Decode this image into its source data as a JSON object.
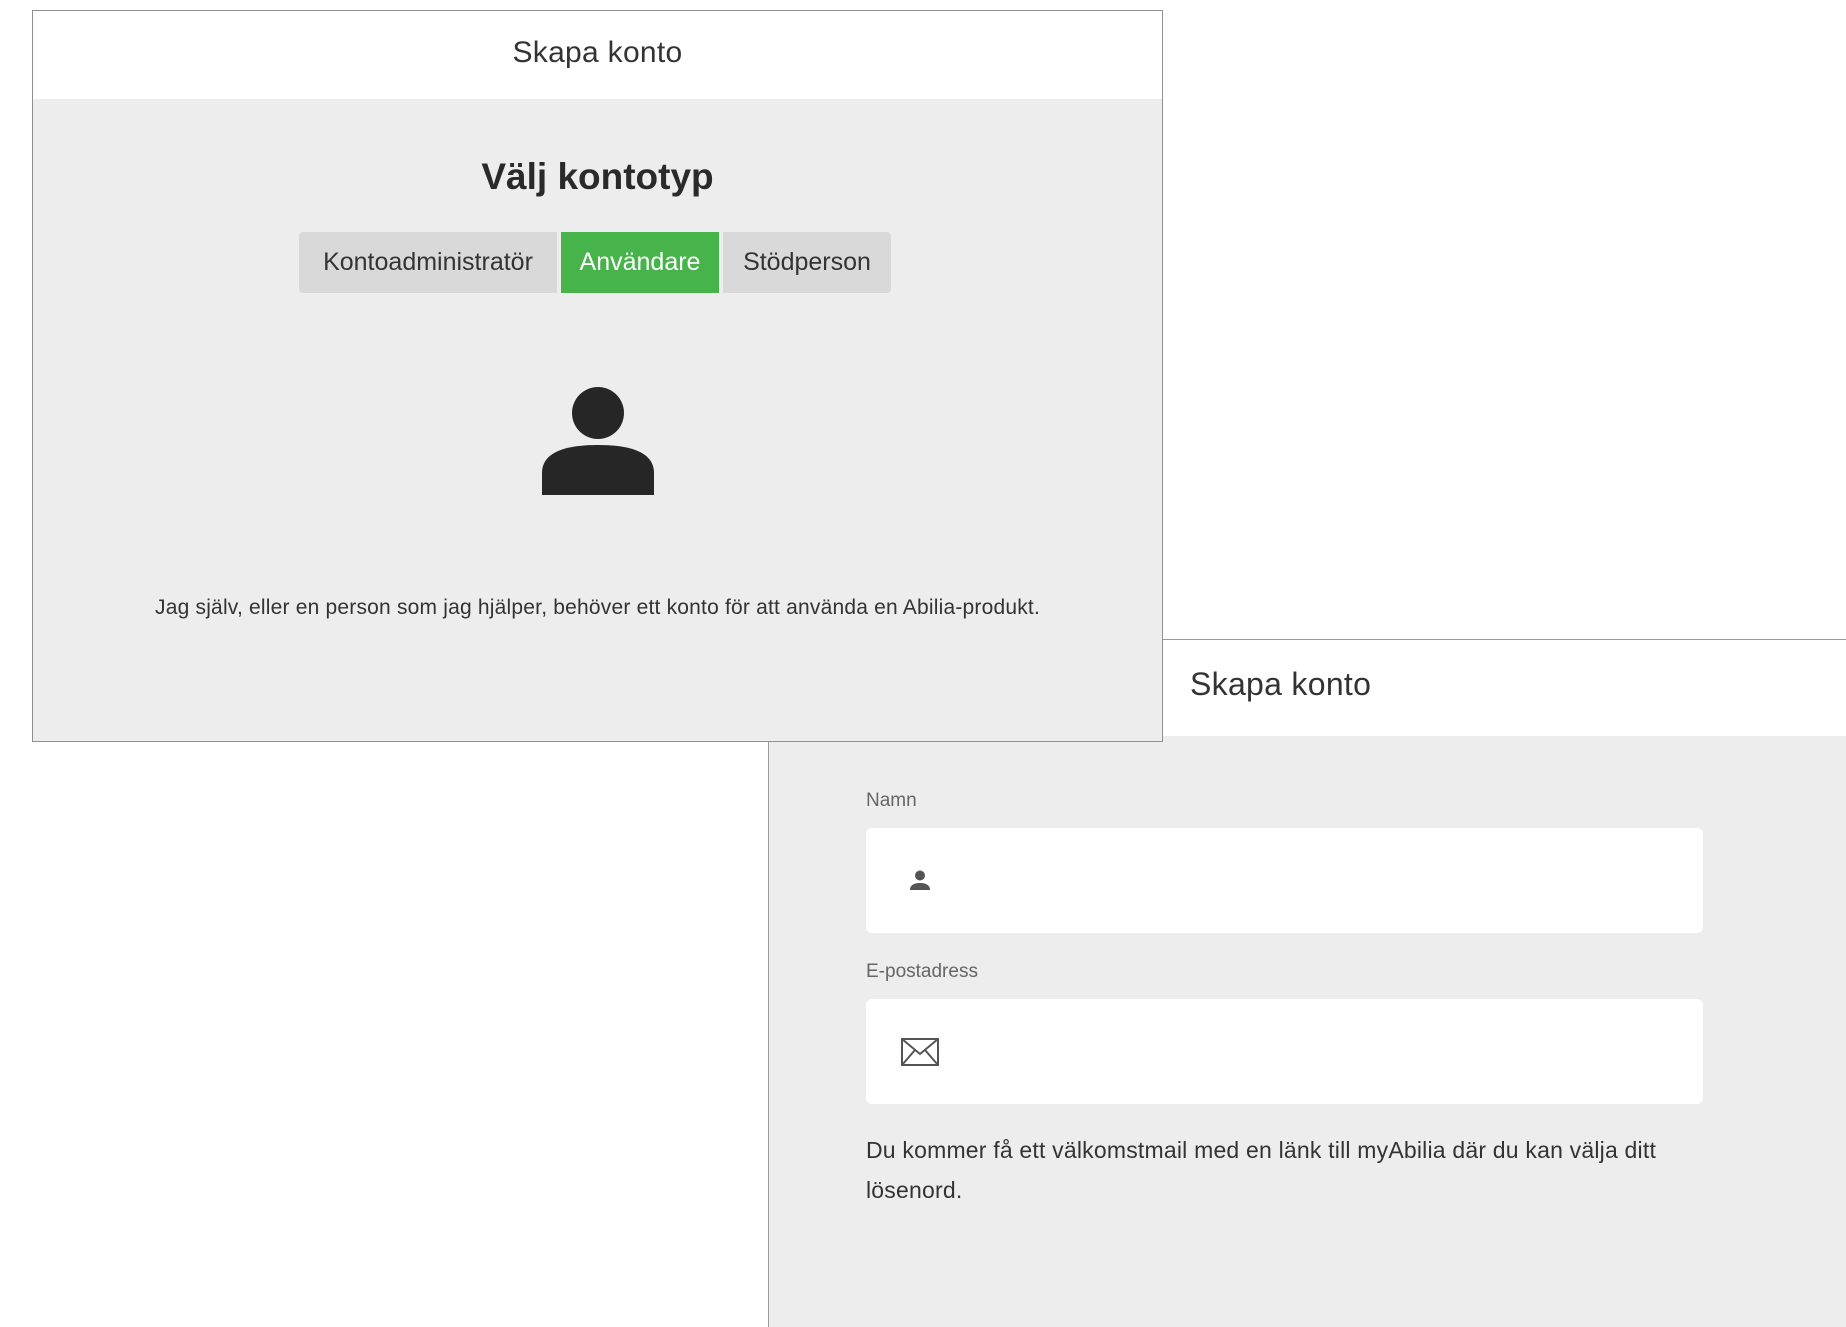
{
  "account_type_dialog": {
    "header_title": "Skapa konto",
    "heading": "Välj kontotyp",
    "options": [
      {
        "label": "Kontoadministratör",
        "selected": false
      },
      {
        "label": "Användare",
        "selected": true
      },
      {
        "label": "Stödperson",
        "selected": false
      }
    ],
    "selected_icon": "person-icon",
    "description": "Jag själv, eller en person som jag hjälper, behöver ett konto för att använda en Abilia-produkt."
  },
  "signup_dialog": {
    "header_title": "Skapa konto",
    "name_field": {
      "label": "Namn",
      "icon": "person-icon",
      "value": ""
    },
    "email_field": {
      "label": "E-postadress",
      "icon": "envelope-icon",
      "value": ""
    },
    "info_text": "Du kommer få ett välkomstmail med en länk till myAbilia där du kan välja ditt lösenord."
  },
  "colors": {
    "accent_selected": "#47b34b",
    "panel_background": "#ededed",
    "button_background": "#d9d9d9"
  }
}
